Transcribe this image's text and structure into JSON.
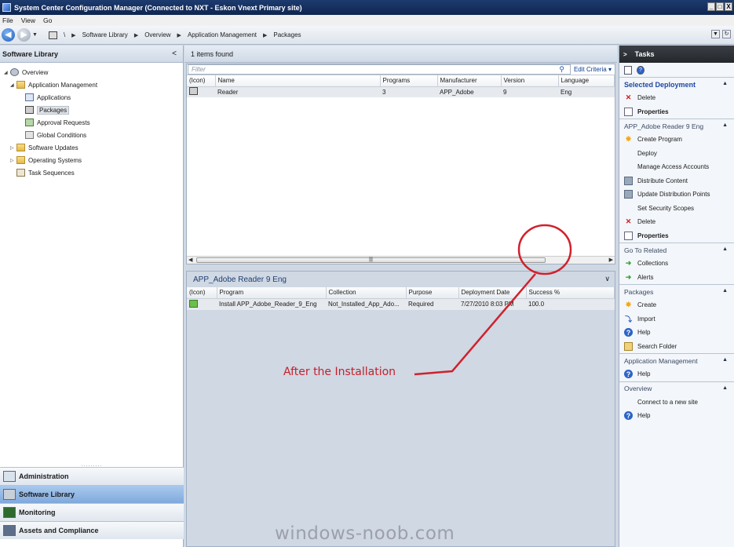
{
  "window": {
    "title": "System Center Configuration Manager (Connected to NXT - Eskon Vnext Primary site)",
    "buttons": [
      "_",
      "□",
      "X"
    ]
  },
  "menu": [
    "File",
    "View",
    "Go"
  ],
  "breadcrumb": [
    "\\",
    "Software Library",
    "Overview",
    "Application Management",
    "Packages"
  ],
  "left": {
    "header": "Software Library",
    "tree": [
      {
        "label": "Overview",
        "icon": "overview-icon"
      },
      {
        "label": "Application Management",
        "icon": "folder-icon"
      },
      {
        "label": "Applications",
        "icon": "applications-icon"
      },
      {
        "label": "Packages",
        "icon": "packages-icon"
      },
      {
        "label": "Approval Requests",
        "icon": "approval-icon"
      },
      {
        "label": "Global Conditions",
        "icon": "global-conditions-icon"
      },
      {
        "label": "Software Updates",
        "icon": "folder-icon"
      },
      {
        "label": "Operating Systems",
        "icon": "folder-icon"
      },
      {
        "label": "Task Sequences",
        "icon": "task-sequence-icon"
      }
    ],
    "workspaces": [
      "Administration",
      "Software Library",
      "Monitoring",
      "Assets and Compliance"
    ]
  },
  "list": {
    "count": "1 items found",
    "filter_placeholder": "Filter",
    "edit_criteria": "Edit Criteria",
    "columns": [
      "(Icon)",
      "Name",
      "Programs",
      "Manufacturer",
      "Version",
      "Language"
    ],
    "rows": [
      {
        "name": "Reader",
        "programs": "3",
        "manufacturer": "APP_Adobe",
        "version": "9",
        "language": "Eng"
      }
    ]
  },
  "detail": {
    "title": "APP_Adobe Reader 9 Eng",
    "columns": [
      "(Icon)",
      "Program",
      "Collection",
      "Purpose",
      "Deployment Date",
      "Success %"
    ],
    "rows": [
      {
        "program": "Install APP_Adobe_Reader_9_Eng",
        "collection": "Not_Installed_App_Ado...",
        "purpose": "Required",
        "date": "7/27/2010 8:03 PM",
        "success": "100.0"
      }
    ]
  },
  "annotation": {
    "text": "After the Installation",
    "color": "#c5202c"
  },
  "watermark": "windows-noob.com",
  "tasks": {
    "header": "Tasks",
    "sections": [
      {
        "title": "Selected Deployment",
        "items": [
          {
            "label": "Delete",
            "icon": "delete-icon"
          },
          {
            "label": "Properties",
            "icon": "properties-icon"
          }
        ]
      },
      {
        "title": "APP_Adobe Reader 9 Eng",
        "items": [
          {
            "label": "Create Program",
            "icon": "create-icon"
          },
          {
            "label": "Deploy",
            "icon": ""
          },
          {
            "label": "Manage Access Accounts",
            "icon": ""
          },
          {
            "label": "Distribute Content",
            "icon": "distribute-icon"
          },
          {
            "label": "Update Distribution Points",
            "icon": "distribute-icon"
          },
          {
            "label": "Set Security Scopes",
            "icon": ""
          },
          {
            "label": "Delete",
            "icon": "delete-icon"
          },
          {
            "label": "Properties",
            "icon": "properties-icon"
          }
        ]
      },
      {
        "title": "Go To Related",
        "items": [
          {
            "label": "Collections",
            "icon": "go-arrow-icon"
          },
          {
            "label": "Alerts",
            "icon": "go-arrow-icon"
          }
        ]
      },
      {
        "title": "Packages",
        "items": [
          {
            "label": "Create",
            "icon": "create-icon"
          },
          {
            "label": "Import",
            "icon": "import-icon"
          },
          {
            "label": "Help",
            "icon": "help-icon"
          },
          {
            "label": "Search Folder",
            "icon": "search-folder-icon"
          }
        ]
      },
      {
        "title": "Application Management",
        "items": [
          {
            "label": "Help",
            "icon": "help-icon"
          }
        ]
      },
      {
        "title": "Overview",
        "items": [
          {
            "label": "Connect to a new site",
            "icon": ""
          },
          {
            "label": "Help",
            "icon": "help-icon"
          }
        ]
      }
    ]
  }
}
